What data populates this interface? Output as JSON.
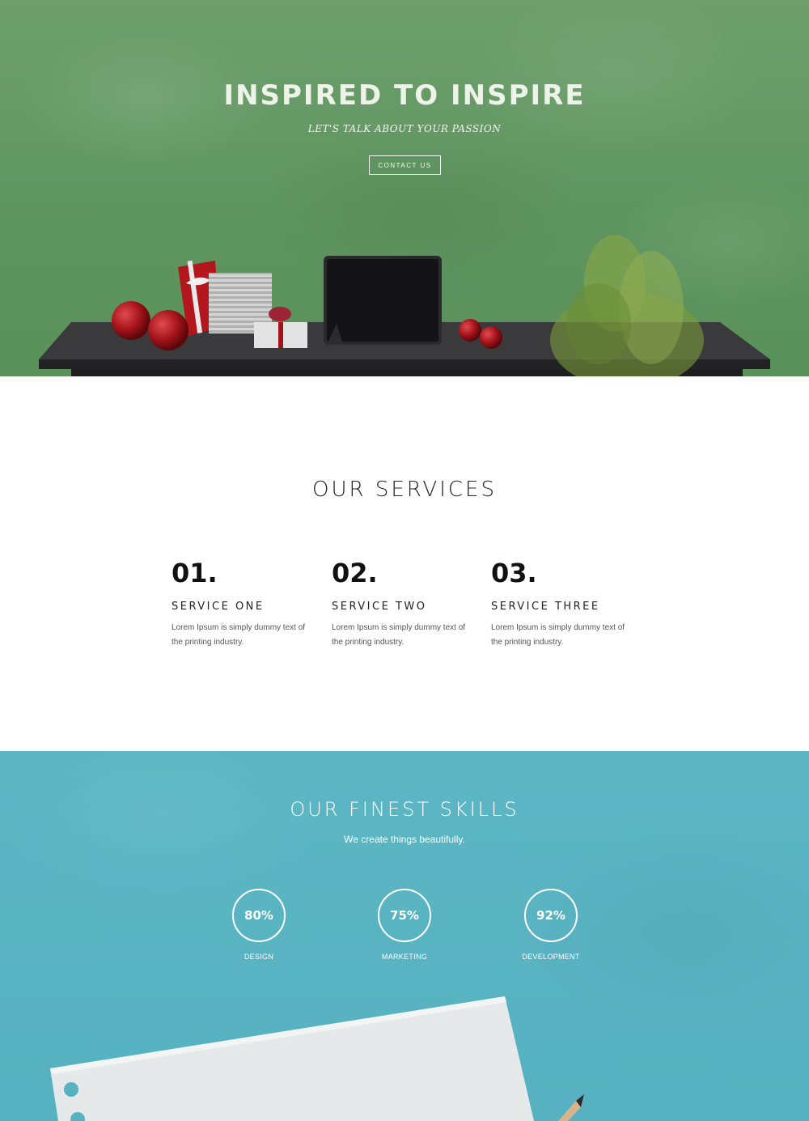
{
  "hero": {
    "title": "INSPIRED TO INSPIRE",
    "subtitle": "LET'S TALK ABOUT YOUR PASSION",
    "button_label": "CONTACT US"
  },
  "services": {
    "title": "OUR SERVICES",
    "items": [
      {
        "number": "01.",
        "name": "SERVICE ONE",
        "description": "Lorem Ipsum is simply dummy text of the printing industry."
      },
      {
        "number": "02.",
        "name": "SERVICE TWO",
        "description": "Lorem Ipsum is simply dummy text of the printing industry."
      },
      {
        "number": "03.",
        "name": "SERVICE THREE",
        "description": "Lorem Ipsum is simply dummy text of the printing industry."
      }
    ]
  },
  "skills": {
    "title": "OUR FINEST SKILLS",
    "subtitle": "We create things beautifully.",
    "items": [
      {
        "value": "80%",
        "label": "DESIGN"
      },
      {
        "value": "75%",
        "label": "MARKETING"
      },
      {
        "value": "92%",
        "label": "DEVELOPMENT"
      }
    ]
  },
  "colors": {
    "hero_green": "#5f9660",
    "skills_teal": "#56b1c0",
    "shelf": "#2f2f31",
    "ornament_red": "#a3131a"
  }
}
